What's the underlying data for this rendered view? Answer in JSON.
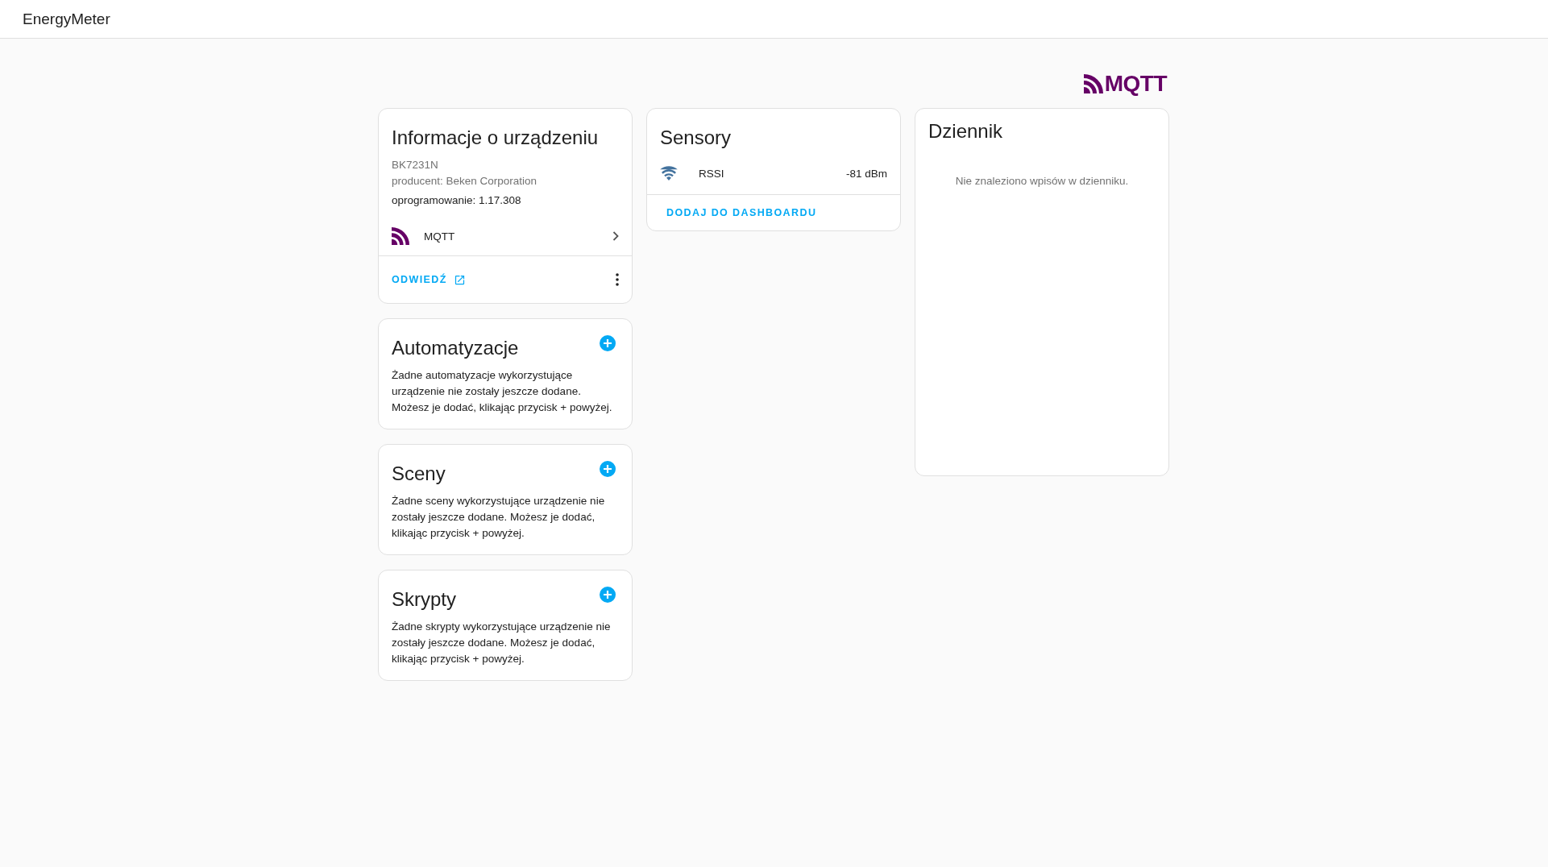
{
  "header": {
    "title": "EnergyMeter"
  },
  "integration_logo": {
    "text": "MQTT"
  },
  "device_info": {
    "title": "Informacje o urządzeniu",
    "model": "BK7231N",
    "manufacturer": "producent: Beken Corporation",
    "firmware": "oprogramowanie: 1.17.308",
    "integrations": [
      {
        "name": "MQTT"
      }
    ],
    "visit": "ODWIEDŹ"
  },
  "related": [
    {
      "title": "Automatyzacje",
      "text": "Żadne automatyzacje wykorzystujące urządzenie nie zostały jeszcze dodane. Możesz je dodać, klikając przycisk + powyżej."
    },
    {
      "title": "Sceny",
      "text": "Żadne sceny wykorzystujące urządzenie nie zostały jeszcze dodane. Możesz je dodać, klikając przycisk + powyżej."
    },
    {
      "title": "Skrypty",
      "text": "Żadne skrypty wykorzystujące urządzenie nie zostały jeszcze dodane. Możesz je dodać, klikając przycisk + powyżej."
    }
  ],
  "sensors": {
    "title": "Sensory",
    "entities": [
      {
        "name": "RSSI",
        "value": "-81 dBm"
      }
    ],
    "action": "DODAJ DO DASHBOARDU"
  },
  "logbook": {
    "title": "Dziennik",
    "empty_text": "Nie znaleziono wpisów w dzienniku."
  }
}
